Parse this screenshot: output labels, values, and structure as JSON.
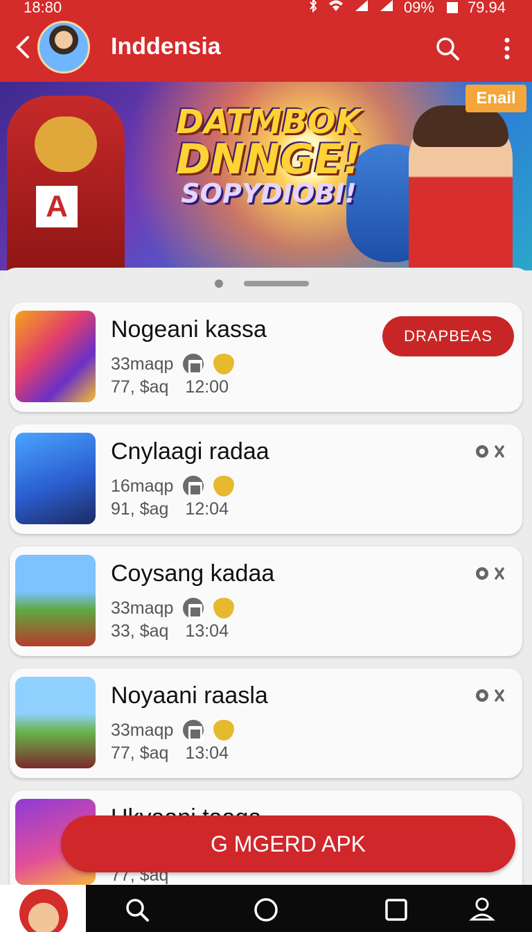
{
  "status_bar": {
    "time": "18:80",
    "battery": "09%",
    "extra": "79.94"
  },
  "app_bar": {
    "title": "Inddensia"
  },
  "banner": {
    "title_line1": "DATMBOK",
    "title_line2": "DNNGE!",
    "title_line3": "SOPYDIOBI!",
    "badge": "Enail"
  },
  "items": [
    {
      "name": "Nogeani kassa",
      "size": "33maqp",
      "count": "77, $aq",
      "time": "12:00",
      "action": "DRAPBEAS"
    },
    {
      "name": "Cnylaagi radaa",
      "size": "16maqp",
      "count": "91, $ag",
      "time": "12:04"
    },
    {
      "name": "Coysang kadaa",
      "size": "33maqp",
      "count": "33, $aq",
      "time": "13:04"
    },
    {
      "name": "Noyaani raasla",
      "size": "33maqp",
      "count": "77, $aq",
      "time": "13:04"
    },
    {
      "name": "Ukyaani taaga",
      "size": "",
      "count": "77, $aq",
      "time": ""
    }
  ],
  "cta": {
    "label": "G MGERD APK"
  },
  "colors": {
    "brand_red": "#d42b2b",
    "button_red": "#c82626",
    "badge_orange": "#f4a63a"
  },
  "icons": [
    "back-arrow-icon",
    "search-icon",
    "more-vert-icon",
    "gift-icon",
    "shield-icon",
    "settings-icon",
    "home-circle-icon",
    "recents-square-icon",
    "profile-icon"
  ]
}
